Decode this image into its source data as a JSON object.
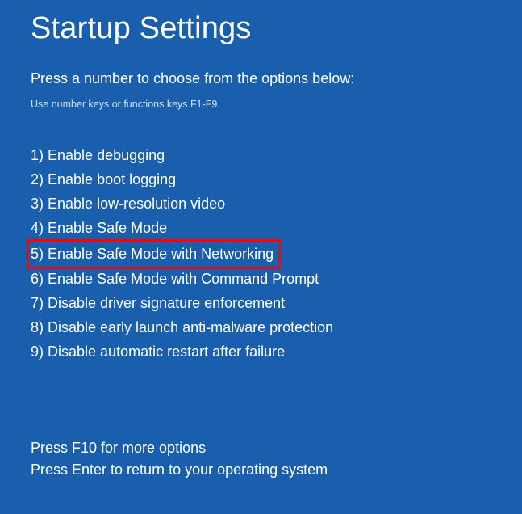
{
  "title": "Startup Settings",
  "instruction": "Press a number to choose from the options below:",
  "hint": "Use number keys or functions keys F1-F9.",
  "options": [
    {
      "num": "1",
      "label": "Enable debugging",
      "highlighted": false
    },
    {
      "num": "2",
      "label": "Enable boot logging",
      "highlighted": false
    },
    {
      "num": "3",
      "label": "Enable low-resolution video",
      "highlighted": false
    },
    {
      "num": "4",
      "label": "Enable Safe Mode",
      "highlighted": false
    },
    {
      "num": "5",
      "label": "Enable Safe Mode with Networking",
      "highlighted": true
    },
    {
      "num": "6",
      "label": "Enable Safe Mode with Command Prompt",
      "highlighted": false
    },
    {
      "num": "7",
      "label": "Disable driver signature enforcement",
      "highlighted": false
    },
    {
      "num": "8",
      "label": "Disable early launch anti-malware protection",
      "highlighted": false
    },
    {
      "num": "9",
      "label": "Disable automatic restart after failure",
      "highlighted": false
    }
  ],
  "footer": {
    "more_options": "Press F10 for more options",
    "return": "Press Enter to return to your operating system"
  }
}
